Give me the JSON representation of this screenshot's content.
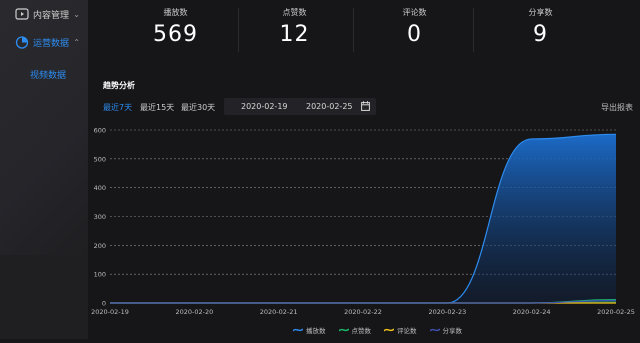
{
  "sidebar": {
    "items": [
      {
        "label": "内容管理",
        "icon": "play-square-icon",
        "expanded": false
      },
      {
        "label": "运营数据",
        "icon": "pie-chart-icon",
        "expanded": true
      }
    ],
    "sub_items": [
      {
        "label": "视频数据",
        "active": true
      }
    ],
    "accent": "#2d8cf0"
  },
  "stats": [
    {
      "label": "播放数",
      "value": "569"
    },
    {
      "label": "点赞数",
      "value": "12"
    },
    {
      "label": "评论数",
      "value": "0"
    },
    {
      "label": "分享数",
      "value": "9"
    }
  ],
  "trend": {
    "title": "趋势分析",
    "ranges": [
      {
        "label": "最近7天",
        "active": true
      },
      {
        "label": "最近15天",
        "active": false
      },
      {
        "label": "最近30天",
        "active": false
      }
    ],
    "date_start": "2020-02-19",
    "date_end": "2020-02-25",
    "export_label": "导出报表"
  },
  "chart_data": {
    "type": "area",
    "categories": [
      "2020-02-19",
      "2020-02-20",
      "2020-02-21",
      "2020-02-22",
      "2020-02-23",
      "2020-02-24",
      "2020-02-25"
    ],
    "yticks": [
      0,
      100,
      200,
      300,
      400,
      500,
      600
    ],
    "ylim": [
      0,
      600
    ],
    "grid": true,
    "legend_position": "bottom",
    "series": [
      {
        "name": "播放数",
        "color": "#2d8cf0",
        "values": [
          0,
          0,
          0,
          0,
          0,
          569,
          585
        ]
      },
      {
        "name": "点赞数",
        "color": "#19be6b",
        "values": [
          0,
          0,
          0,
          0,
          0,
          0,
          12
        ]
      },
      {
        "name": "评论数",
        "color": "#f5c518",
        "values": [
          0,
          0,
          0,
          0,
          0,
          0,
          0
        ]
      },
      {
        "name": "分享数",
        "color": "#3f51b5",
        "values": [
          0,
          0,
          0,
          0,
          0,
          0,
          9
        ]
      }
    ]
  }
}
